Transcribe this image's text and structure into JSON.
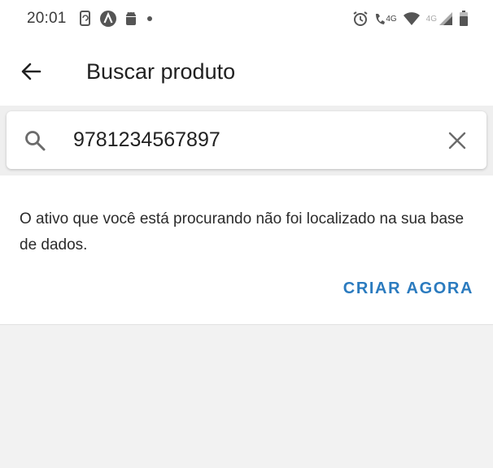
{
  "status_bar": {
    "time": "20:01",
    "left_icons": [
      "phone-sync-icon",
      "app-a-icon",
      "android-icon",
      "dot-icon"
    ],
    "right_icons": [
      "alarm-icon",
      "volte-call-icon",
      "wifi-icon",
      "signal-icon",
      "battery-icon"
    ],
    "network_label_1": "4G",
    "network_label_2": "4G"
  },
  "app_bar": {
    "title": "Buscar produto",
    "back_icon": "arrow-back-icon"
  },
  "search": {
    "value": "9781234567897",
    "search_icon": "search-icon",
    "clear_icon": "close-icon"
  },
  "result": {
    "message": "O ativo que você está procurando não foi localizado na sua base de dados.",
    "action_label": "CRIAR AGORA"
  },
  "colors": {
    "accent": "#2b7bbf",
    "background": "#f2f2f2",
    "surface": "#ffffff"
  }
}
